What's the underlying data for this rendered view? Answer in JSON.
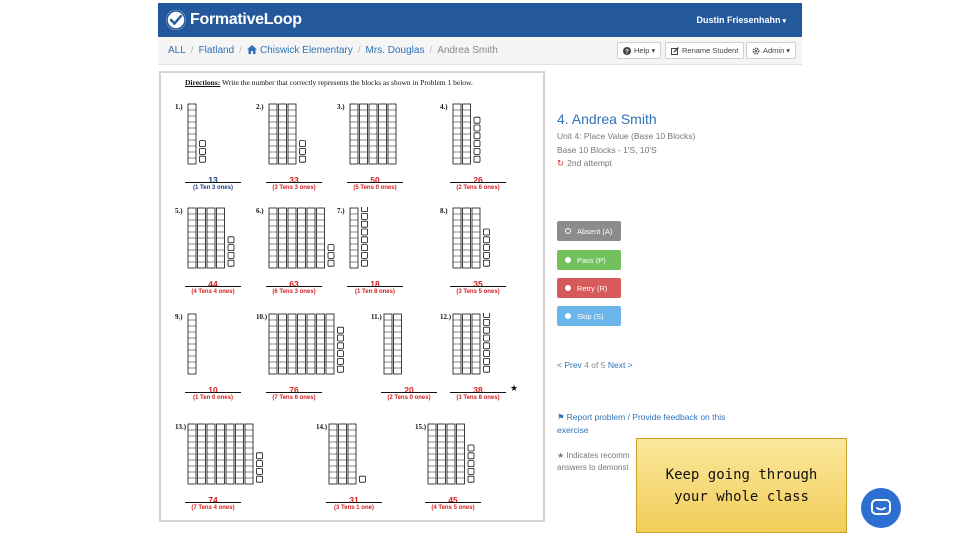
{
  "app": {
    "name": "FormativeLoop",
    "user_name": "Dustin Friesenhahn"
  },
  "breadcrumb": [
    {
      "label": "ALL"
    },
    {
      "label": "Flatland"
    },
    {
      "label": "Chiswick Elementary",
      "icon": "home-icon"
    },
    {
      "label": "Mrs. Douglas"
    },
    {
      "label": "Andrea Smith"
    }
  ],
  "toolbar": {
    "help_label": "Help",
    "rename_label": "Rename Student",
    "admin_label": "Admin"
  },
  "worksheet": {
    "directions_label": "Directions:",
    "directions_text": "Write the number that correctly represents the blocks as shown in Problem 1 below.",
    "problems": [
      {
        "num": "1.)",
        "tens": 1,
        "ones": 3,
        "answer": "13",
        "explanation": "(1 Ten 3 ones)",
        "status": "correct"
      },
      {
        "num": "2.)",
        "tens": 3,
        "ones": 3,
        "answer": "33",
        "explanation": "(3 Tens 3 ones)",
        "status": "incorrect"
      },
      {
        "num": "3.)",
        "tens": 5,
        "ones": 0,
        "answer": "50",
        "explanation": "(5 Tens 0 ones)",
        "status": "incorrect"
      },
      {
        "num": "4.)",
        "tens": 2,
        "ones": 6,
        "answer": "26",
        "explanation": "(2 Tens 6 ones)",
        "status": "incorrect"
      },
      {
        "num": "5.)",
        "tens": 4,
        "ones": 4,
        "answer": "44",
        "explanation": "(4 Tens 4 ones)",
        "status": "incorrect"
      },
      {
        "num": "6.)",
        "tens": 6,
        "ones": 3,
        "answer": "63",
        "explanation": "(6 Tens 3 ones)",
        "status": "incorrect"
      },
      {
        "num": "7.)",
        "tens": 1,
        "ones": 8,
        "answer": "18",
        "explanation": "(1 Ten 8 ones)",
        "status": "incorrect"
      },
      {
        "num": "8.)",
        "tens": 3,
        "ones": 5,
        "answer": "35",
        "explanation": "(3 Tens 5 ones)",
        "status": "incorrect"
      },
      {
        "num": "9.)",
        "tens": 1,
        "ones": 0,
        "answer": "10",
        "explanation": "(1 Ten 0 ones)",
        "status": "incorrect"
      },
      {
        "num": "10.)",
        "tens": 7,
        "ones": 6,
        "answer": "76",
        "explanation": "(7 Tens 6 ones)",
        "status": "incorrect"
      },
      {
        "num": "11.)",
        "tens": 2,
        "ones": 0,
        "answer": "20",
        "explanation": "(2 Tens 0 ones)",
        "status": "incorrect"
      },
      {
        "num": "12.)",
        "tens": 3,
        "ones": 8,
        "answer": "38",
        "explanation": "(3 Tens 8 ones)",
        "status": "incorrect",
        "starred": true
      },
      {
        "num": "13.)",
        "tens": 7,
        "ones": 4,
        "answer": "74",
        "explanation": "(7 Tens 4 ones)",
        "status": "incorrect"
      },
      {
        "num": "14.)",
        "tens": 3,
        "ones": 1,
        "answer": "31",
        "explanation": "(3 Tens 1 one)",
        "status": "incorrect"
      },
      {
        "num": "15.)",
        "tens": 4,
        "ones": 5,
        "answer": "45",
        "explanation": "(4 Tens 5 ones)",
        "status": "incorrect"
      }
    ]
  },
  "student": {
    "title": "4. Andrea Smith",
    "unit": "Unit 4: Place Value (Base 10 Blocks)",
    "skill": "Base 10 Blocks - 1'S, 10'S",
    "attempt": "2nd attempt"
  },
  "actions": {
    "absent": "Absent (A)",
    "pass": "Pass (P)",
    "retry": "Retry (R)",
    "skip": "Skip (S)"
  },
  "pager": {
    "prev": "< Prev",
    "position": "4 of 5",
    "next": "Next >"
  },
  "report": {
    "text": "Report problem / Provide feedback on this exercise"
  },
  "note": {
    "line1": "★ Indicates recomm",
    "line2": "answers to demonst"
  },
  "caption": {
    "text": "Keep going through your whole class"
  },
  "colors": {
    "nav": "#23599c",
    "link": "#2f72b8",
    "correct": "#1e3f86",
    "incorrect": "#d3201f",
    "absent": "#8c8c8c",
    "pass": "#72c05c",
    "retry": "#d75a5a",
    "skip": "#6ab5ea",
    "caption_bg": "#f2cd5a"
  }
}
